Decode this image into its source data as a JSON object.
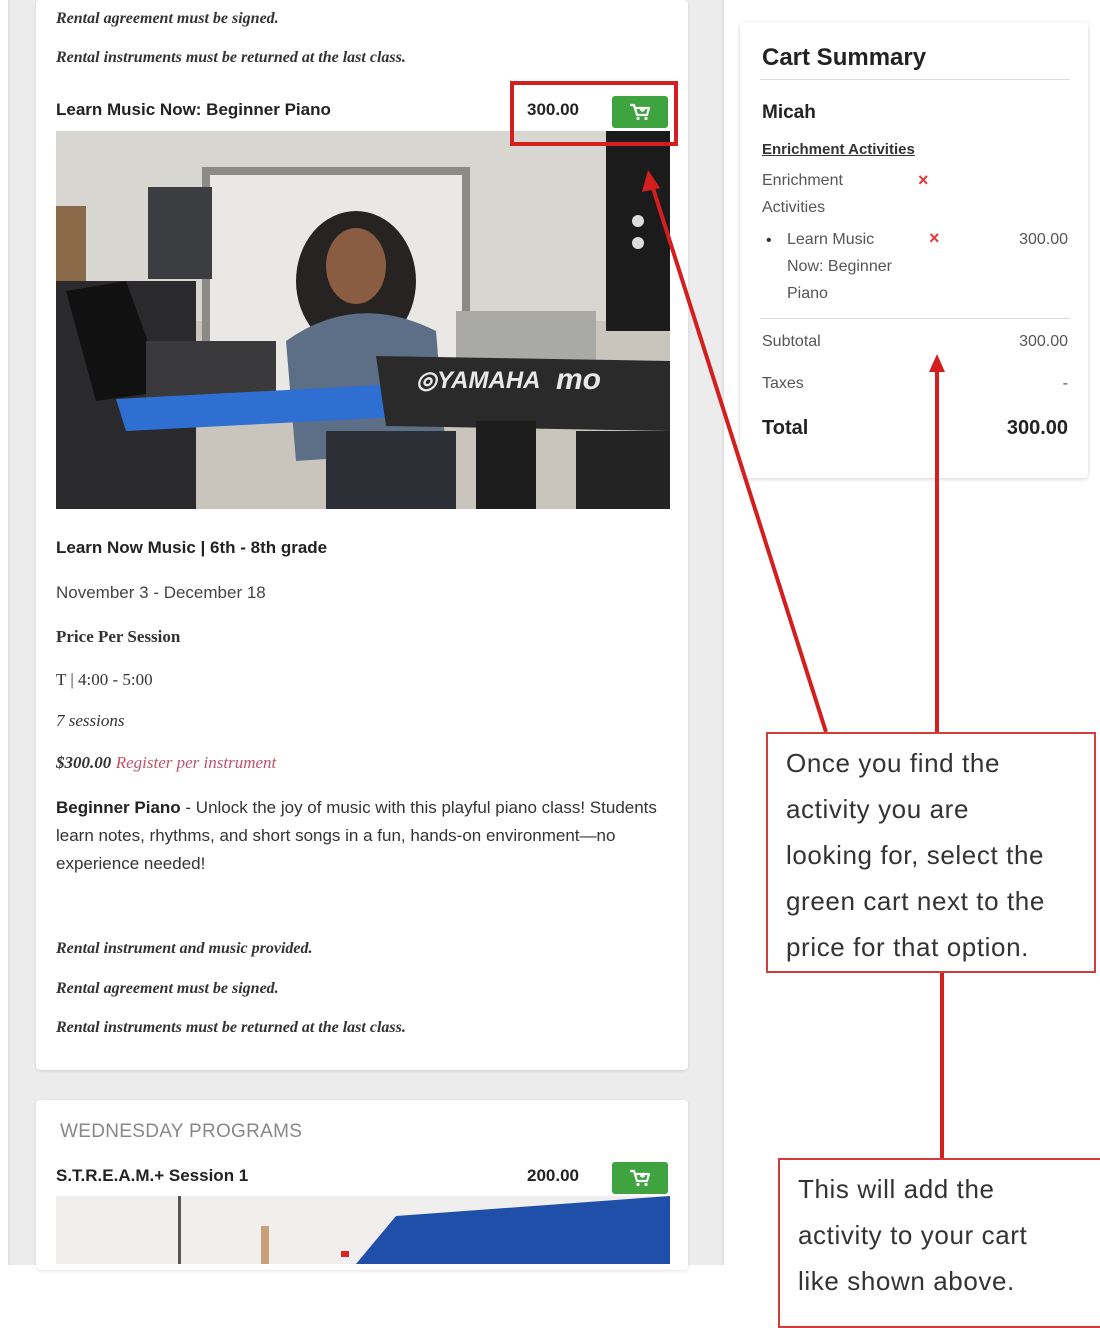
{
  "main_card": {
    "top_rental_signed": "Rental agreement must be signed.",
    "top_rental_return": "Rental instruments must be returned at the last class.",
    "activity": {
      "title": "Learn Music Now: Beginner Piano",
      "price": "300.00",
      "cart_icon": "cart-icon",
      "subtitle": "Learn Now Music | 6th - 8th grade",
      "dates": "November 3 - December 18",
      "price_label": "Price Per Session",
      "schedule": "T | 4:00 - 5:00",
      "sessions": "7 sessions",
      "price_amount": "$300.00",
      "register_note": "Register per instrument",
      "description_lead": "Beginner Piano",
      "description_body": " - Unlock the joy of music with this playful piano class! Students learn notes, rhythms, and short songs in a fun, hands-on environment—no experience needed!",
      "rental_provided": "Rental instrument and music provided.",
      "rental_signed": "Rental agreement must be signed.",
      "rental_return": "Rental instruments must be returned at the last class."
    }
  },
  "wednesday": {
    "header": "WEDNESDAY PROGRAMS",
    "activity_title": "S.T.R.E.A.M.+ Session 1",
    "price": "200.00"
  },
  "cart_summary": {
    "title": "Cart Summary",
    "participant": "Micah",
    "category_link": "Enrichment Activities",
    "category_line1": "Enrichment",
    "category_line2": "Activities",
    "item_line1": "Learn Music",
    "item_line2": "Now: Beginner",
    "item_line3": "Piano",
    "item_price": "300.00",
    "remove_symbol": "×",
    "subtotal_label": "Subtotal",
    "subtotal_value": "300.00",
    "taxes_label": "Taxes",
    "taxes_value": "-",
    "total_label": "Total",
    "total_value": "300.00"
  },
  "callouts": {
    "first": [
      "Once you find the",
      "activity you are",
      "looking for, select the",
      "green cart next to the",
      "price for that option."
    ],
    "second": [
      "This will add the",
      "activity to your cart",
      "like shown above."
    ]
  },
  "colors": {
    "cart_green": "#3fa33f",
    "annotation_red": "#d41f1f",
    "remove_red": "#e23b3b",
    "register_pink": "#c0536a"
  }
}
